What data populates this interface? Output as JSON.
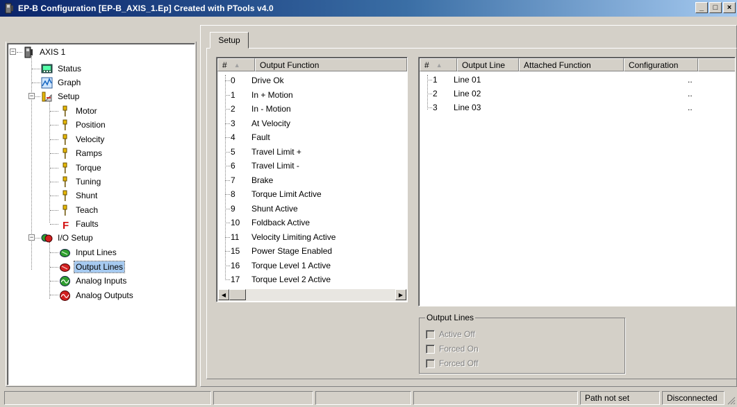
{
  "window": {
    "title": "EP-B Configuration  [EP-B_AXIS_1.Ep] Created with PTools v4.0",
    "controls": [
      "_",
      "□",
      "×"
    ]
  },
  "tree": {
    "root": "AXIS 1",
    "items": [
      {
        "label": "Status",
        "icon": "status-monitor-icon"
      },
      {
        "label": "Graph",
        "icon": "graph-icon"
      },
      {
        "label": "Setup",
        "icon": "setup-icon"
      },
      {
        "label": "Motor",
        "icon": "param-pin-icon"
      },
      {
        "label": "Position",
        "icon": "param-pin-icon"
      },
      {
        "label": "Velocity",
        "icon": "param-pin-icon"
      },
      {
        "label": "Ramps",
        "icon": "param-pin-icon"
      },
      {
        "label": "Torque",
        "icon": "param-pin-icon"
      },
      {
        "label": "Tuning",
        "icon": "param-pin-icon"
      },
      {
        "label": "Shunt",
        "icon": "param-pin-icon"
      },
      {
        "label": "Teach",
        "icon": "param-pin-icon"
      },
      {
        "label": "Faults",
        "icon": "faults-f-icon"
      },
      {
        "label": "I/O Setup",
        "icon": "io-setup-icon"
      },
      {
        "label": "Input Lines",
        "icon": "input-lines-icon"
      },
      {
        "label": "Output Lines",
        "icon": "output-lines-icon"
      },
      {
        "label": "Analog Inputs",
        "icon": "analog-inputs-icon"
      },
      {
        "label": "Analog Outputs",
        "icon": "analog-outputs-icon"
      }
    ]
  },
  "tab": {
    "label": "Setup"
  },
  "functions_list": {
    "headers": {
      "num": "#",
      "name": "Output Function"
    },
    "rows": [
      {
        "num": "0",
        "name": "Drive Ok"
      },
      {
        "num": "1",
        "name": "In + Motion"
      },
      {
        "num": "2",
        "name": "In - Motion"
      },
      {
        "num": "3",
        "name": "At Velocity"
      },
      {
        "num": "4",
        "name": "Fault"
      },
      {
        "num": "5",
        "name": "Travel Limit +"
      },
      {
        "num": "6",
        "name": "Travel Limit -"
      },
      {
        "num": "7",
        "name": "Brake"
      },
      {
        "num": "8",
        "name": "Torque Limit Active"
      },
      {
        "num": "9",
        "name": "Shunt Active"
      },
      {
        "num": "10",
        "name": "Foldback Active"
      },
      {
        "num": "11",
        "name": "Velocity Limiting Active"
      },
      {
        "num": "15",
        "name": "Power Stage Enabled"
      },
      {
        "num": "16",
        "name": "Torque Level 1 Active"
      },
      {
        "num": "17",
        "name": "Torque Level 2 Active"
      }
    ]
  },
  "lines_list": {
    "headers": {
      "num": "#",
      "line": "Output Line",
      "attached": "Attached Function",
      "config": "Configuration"
    },
    "rows": [
      {
        "num": "1",
        "line": "Line 01",
        "attached": "",
        "config": ".."
      },
      {
        "num": "2",
        "line": "Line 02",
        "attached": "",
        "config": ".."
      },
      {
        "num": "3",
        "line": "Line 03",
        "attached": "",
        "config": ".."
      }
    ]
  },
  "output_lines_group": {
    "title": "Output Lines",
    "options": [
      "Active Off",
      "Forced On",
      "Forced Off"
    ]
  },
  "statusbar": {
    "path": "Path not set",
    "connection": "Disconnected"
  }
}
